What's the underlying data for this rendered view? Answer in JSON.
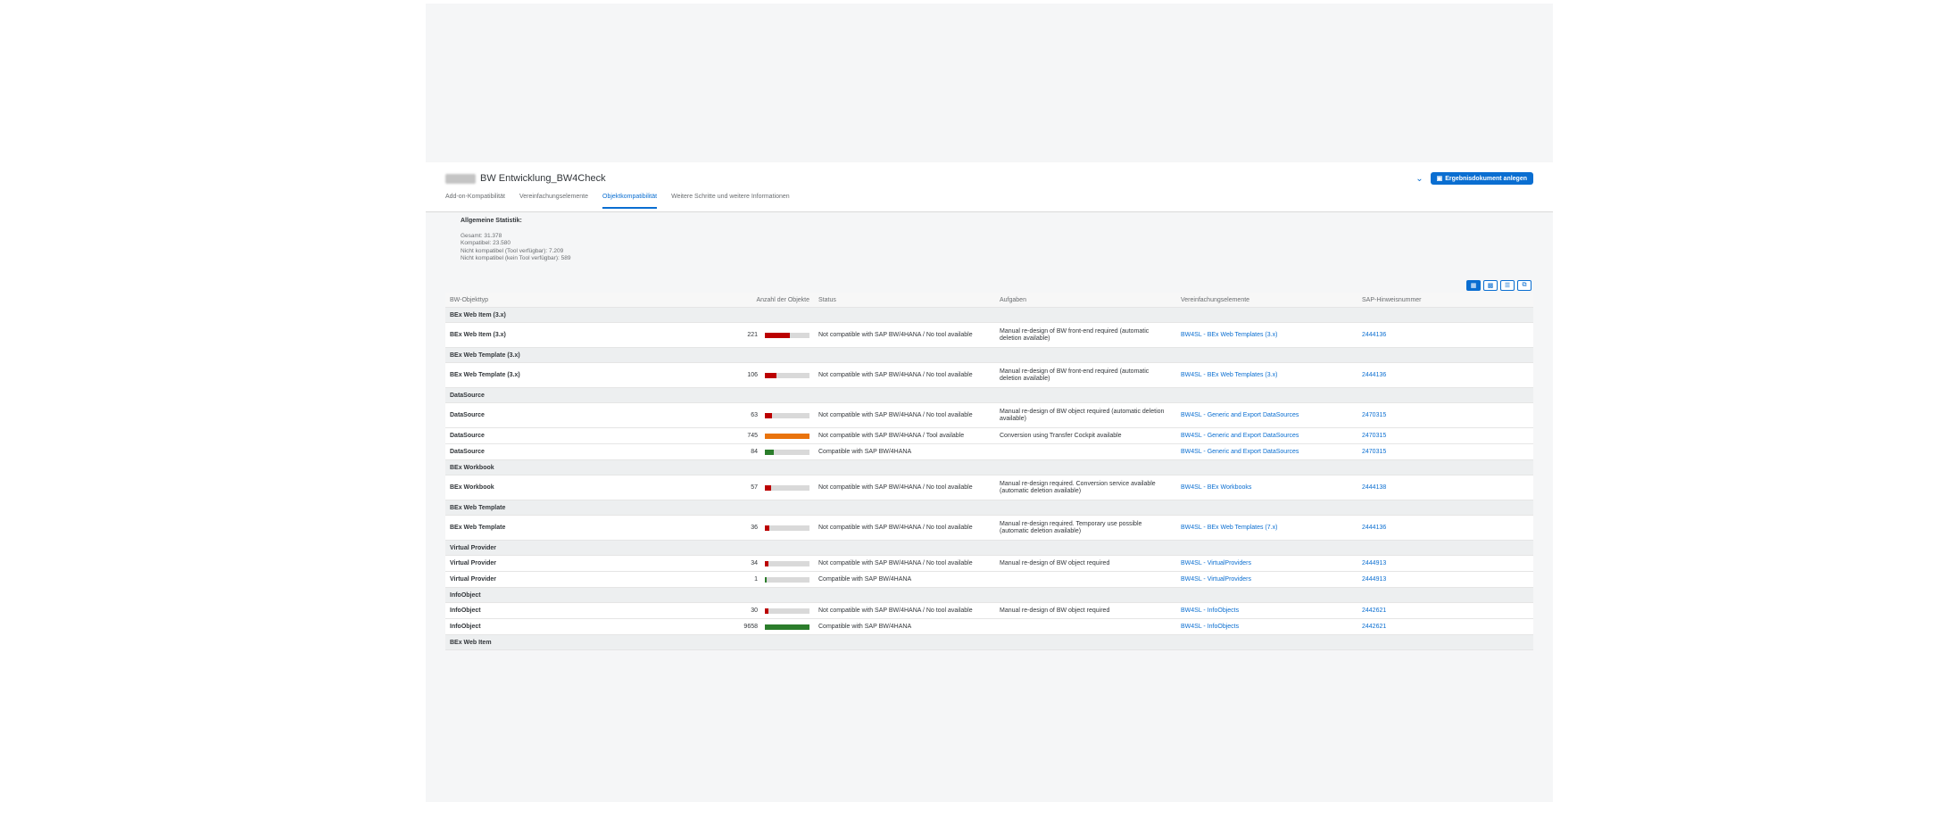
{
  "header": {
    "title": "BW Entwicklung_BW4Check",
    "action_button_label": "Ergebnisdokument anlegen"
  },
  "tabs": [
    {
      "label": "Add-on-Kompatibilität",
      "active": false
    },
    {
      "label": "Vereinfachungselemente",
      "active": false
    },
    {
      "label": "Objektkompatibilität",
      "active": true
    },
    {
      "label": "Weitere Schritte und weitere Informationen",
      "active": false
    }
  ],
  "stats": {
    "heading": "Allgemeine Statistik:",
    "lines": [
      "Gesamt: 31.378",
      "Kompatibel: 23.580",
      "Nicht kompatibel (Tool verfügbar): 7.209",
      "Nicht kompatibel (kein Tool verfügbar): 589"
    ]
  },
  "view_switch": [
    "table-icon",
    "chart-icon",
    "filter-icon",
    "export-icon"
  ],
  "table": {
    "columns": [
      "BW-Objekttyp",
      "Anzahl der Objekte",
      "Status",
      "Aufgaben",
      "Vereinfachungselemente",
      "SAP-Hinweisnummer"
    ],
    "rows": [
      {
        "kind": "group",
        "label": "BEx Web Item (3.x)"
      },
      {
        "kind": "data",
        "type": "BEx Web Item (3.x)",
        "count": "221",
        "fill": 0.55,
        "color": "#bb0000",
        "status": "Not compatible with SAP BW/4HANA / No tool available",
        "task": "Manual re-design of BW front-end required (automatic deletion available)",
        "element": "BW4SL - BEx Web Templates (3.x)",
        "note": "2444136"
      },
      {
        "kind": "group",
        "label": "BEx Web Template (3.x)"
      },
      {
        "kind": "data",
        "type": "BEx Web Template (3.x)",
        "count": "106",
        "fill": 0.26,
        "color": "#bb0000",
        "status": "Not compatible with SAP BW/4HANA / No tool available",
        "task": "Manual re-design of BW front-end required (automatic deletion available)",
        "element": "BW4SL - BEx Web Templates (3.x)",
        "note": "2444136"
      },
      {
        "kind": "group",
        "label": "DataSource"
      },
      {
        "kind": "data",
        "type": "DataSource",
        "count": "63",
        "fill": 0.16,
        "color": "#bb0000",
        "status": "Not compatible with SAP BW/4HANA / No tool available",
        "task": "Manual re-design of BW object required (automatic deletion available)",
        "element": "BW4SL - Generic and Export DataSources",
        "note": "2470315"
      },
      {
        "kind": "data",
        "type": "DataSource",
        "count": "745",
        "fill": 1.0,
        "color": "#e9730c",
        "status": "Not compatible with SAP BW/4HANA / Tool available",
        "task": "Conversion using Transfer Cockpit available",
        "element": "BW4SL - Generic and Export DataSources",
        "note": "2470315"
      },
      {
        "kind": "data",
        "type": "DataSource",
        "count": "84",
        "fill": 0.2,
        "color": "#2b7d2b",
        "status": "Compatible with SAP BW/4HANA",
        "task": "",
        "element": "BW4SL - Generic and Export DataSources",
        "note": "2470315"
      },
      {
        "kind": "group",
        "label": "BEx Workbook"
      },
      {
        "kind": "data",
        "type": "BEx Workbook",
        "count": "57",
        "fill": 0.14,
        "color": "#bb0000",
        "status": "Not compatible with SAP BW/4HANA / No tool available",
        "task": "Manual re-design required. Conversion service available (automatic deletion available)",
        "element": "BW4SL - BEx Workbooks",
        "note": "2444138"
      },
      {
        "kind": "group",
        "label": "BEx Web Template"
      },
      {
        "kind": "data",
        "type": "BEx Web Template",
        "count": "36",
        "fill": 0.09,
        "color": "#bb0000",
        "status": "Not compatible with SAP BW/4HANA / No tool available",
        "task": "Manual re-design required. Temporary use possible (automatic deletion available)",
        "element": "BW4SL - BEx Web Templates (7.x)",
        "note": "2444136"
      },
      {
        "kind": "group",
        "label": "Virtual Provider"
      },
      {
        "kind": "data",
        "type": "Virtual Provider",
        "count": "34",
        "fill": 0.08,
        "color": "#bb0000",
        "status": "Not compatible with SAP BW/4HANA / No tool available",
        "task": "Manual re-design of BW object required",
        "element": "BW4SL - VirtualProviders",
        "note": "2444913"
      },
      {
        "kind": "data",
        "type": "Virtual Provider",
        "count": "1",
        "fill": 0.03,
        "color": "#2b7d2b",
        "status": "Compatible with SAP BW/4HANA",
        "task": "",
        "element": "BW4SL - VirtualProviders",
        "note": "2444913"
      },
      {
        "kind": "group",
        "label": "InfoObject"
      },
      {
        "kind": "data",
        "type": "InfoObject",
        "count": "30",
        "fill": 0.07,
        "color": "#bb0000",
        "status": "Not compatible with SAP BW/4HANA / No tool available",
        "task": "Manual re-design of BW object required",
        "element": "BW4SL - InfoObjects",
        "note": "2442621"
      },
      {
        "kind": "data",
        "type": "InfoObject",
        "count": "9658",
        "fill": 1.0,
        "color": "#2b7d2b",
        "status": "Compatible with SAP BW/4HANA",
        "task": "",
        "element": "BW4SL - InfoObjects",
        "note": "2442621",
        "focused": true
      },
      {
        "kind": "group",
        "label": "BEx Web Item"
      }
    ]
  }
}
